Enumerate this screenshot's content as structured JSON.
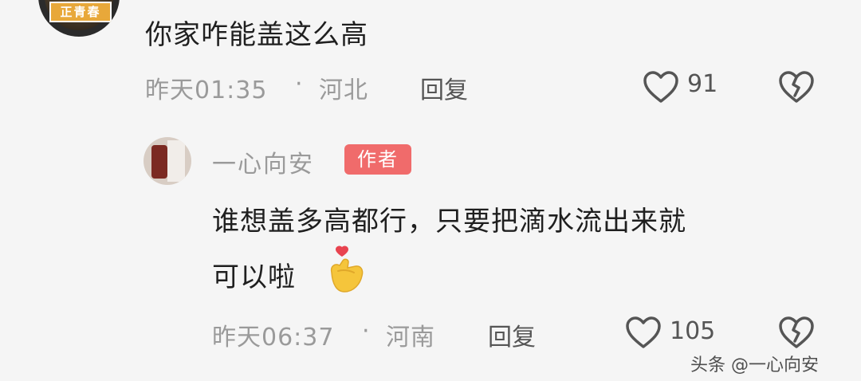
{
  "comment": {
    "avatar_badge": "正青春",
    "text": "你家咋能盖这么高",
    "time": "昨天01:35",
    "separator": "·",
    "location": "河北",
    "reply_label": "回复",
    "like_count": "91"
  },
  "reply": {
    "author": "一心向安",
    "author_tag": "作者",
    "text_line1": "谁想盖多高都行，只要把滴水流出来就",
    "text_line2": "可以啦",
    "time": "昨天06:37",
    "separator": "·",
    "location": "河南",
    "reply_label": "回复",
    "like_count": "105"
  },
  "watermark": "头条 @一心向安",
  "icons": [
    "heart-outline-icon",
    "broken-heart-icon",
    "finger-heart-emoji"
  ],
  "colors": {
    "author_tag_bg": "#f06b6b",
    "meta_text": "#9a9a9a",
    "emoji_yellow": "#f5c53b",
    "emoji_heart": "#e8434f"
  }
}
